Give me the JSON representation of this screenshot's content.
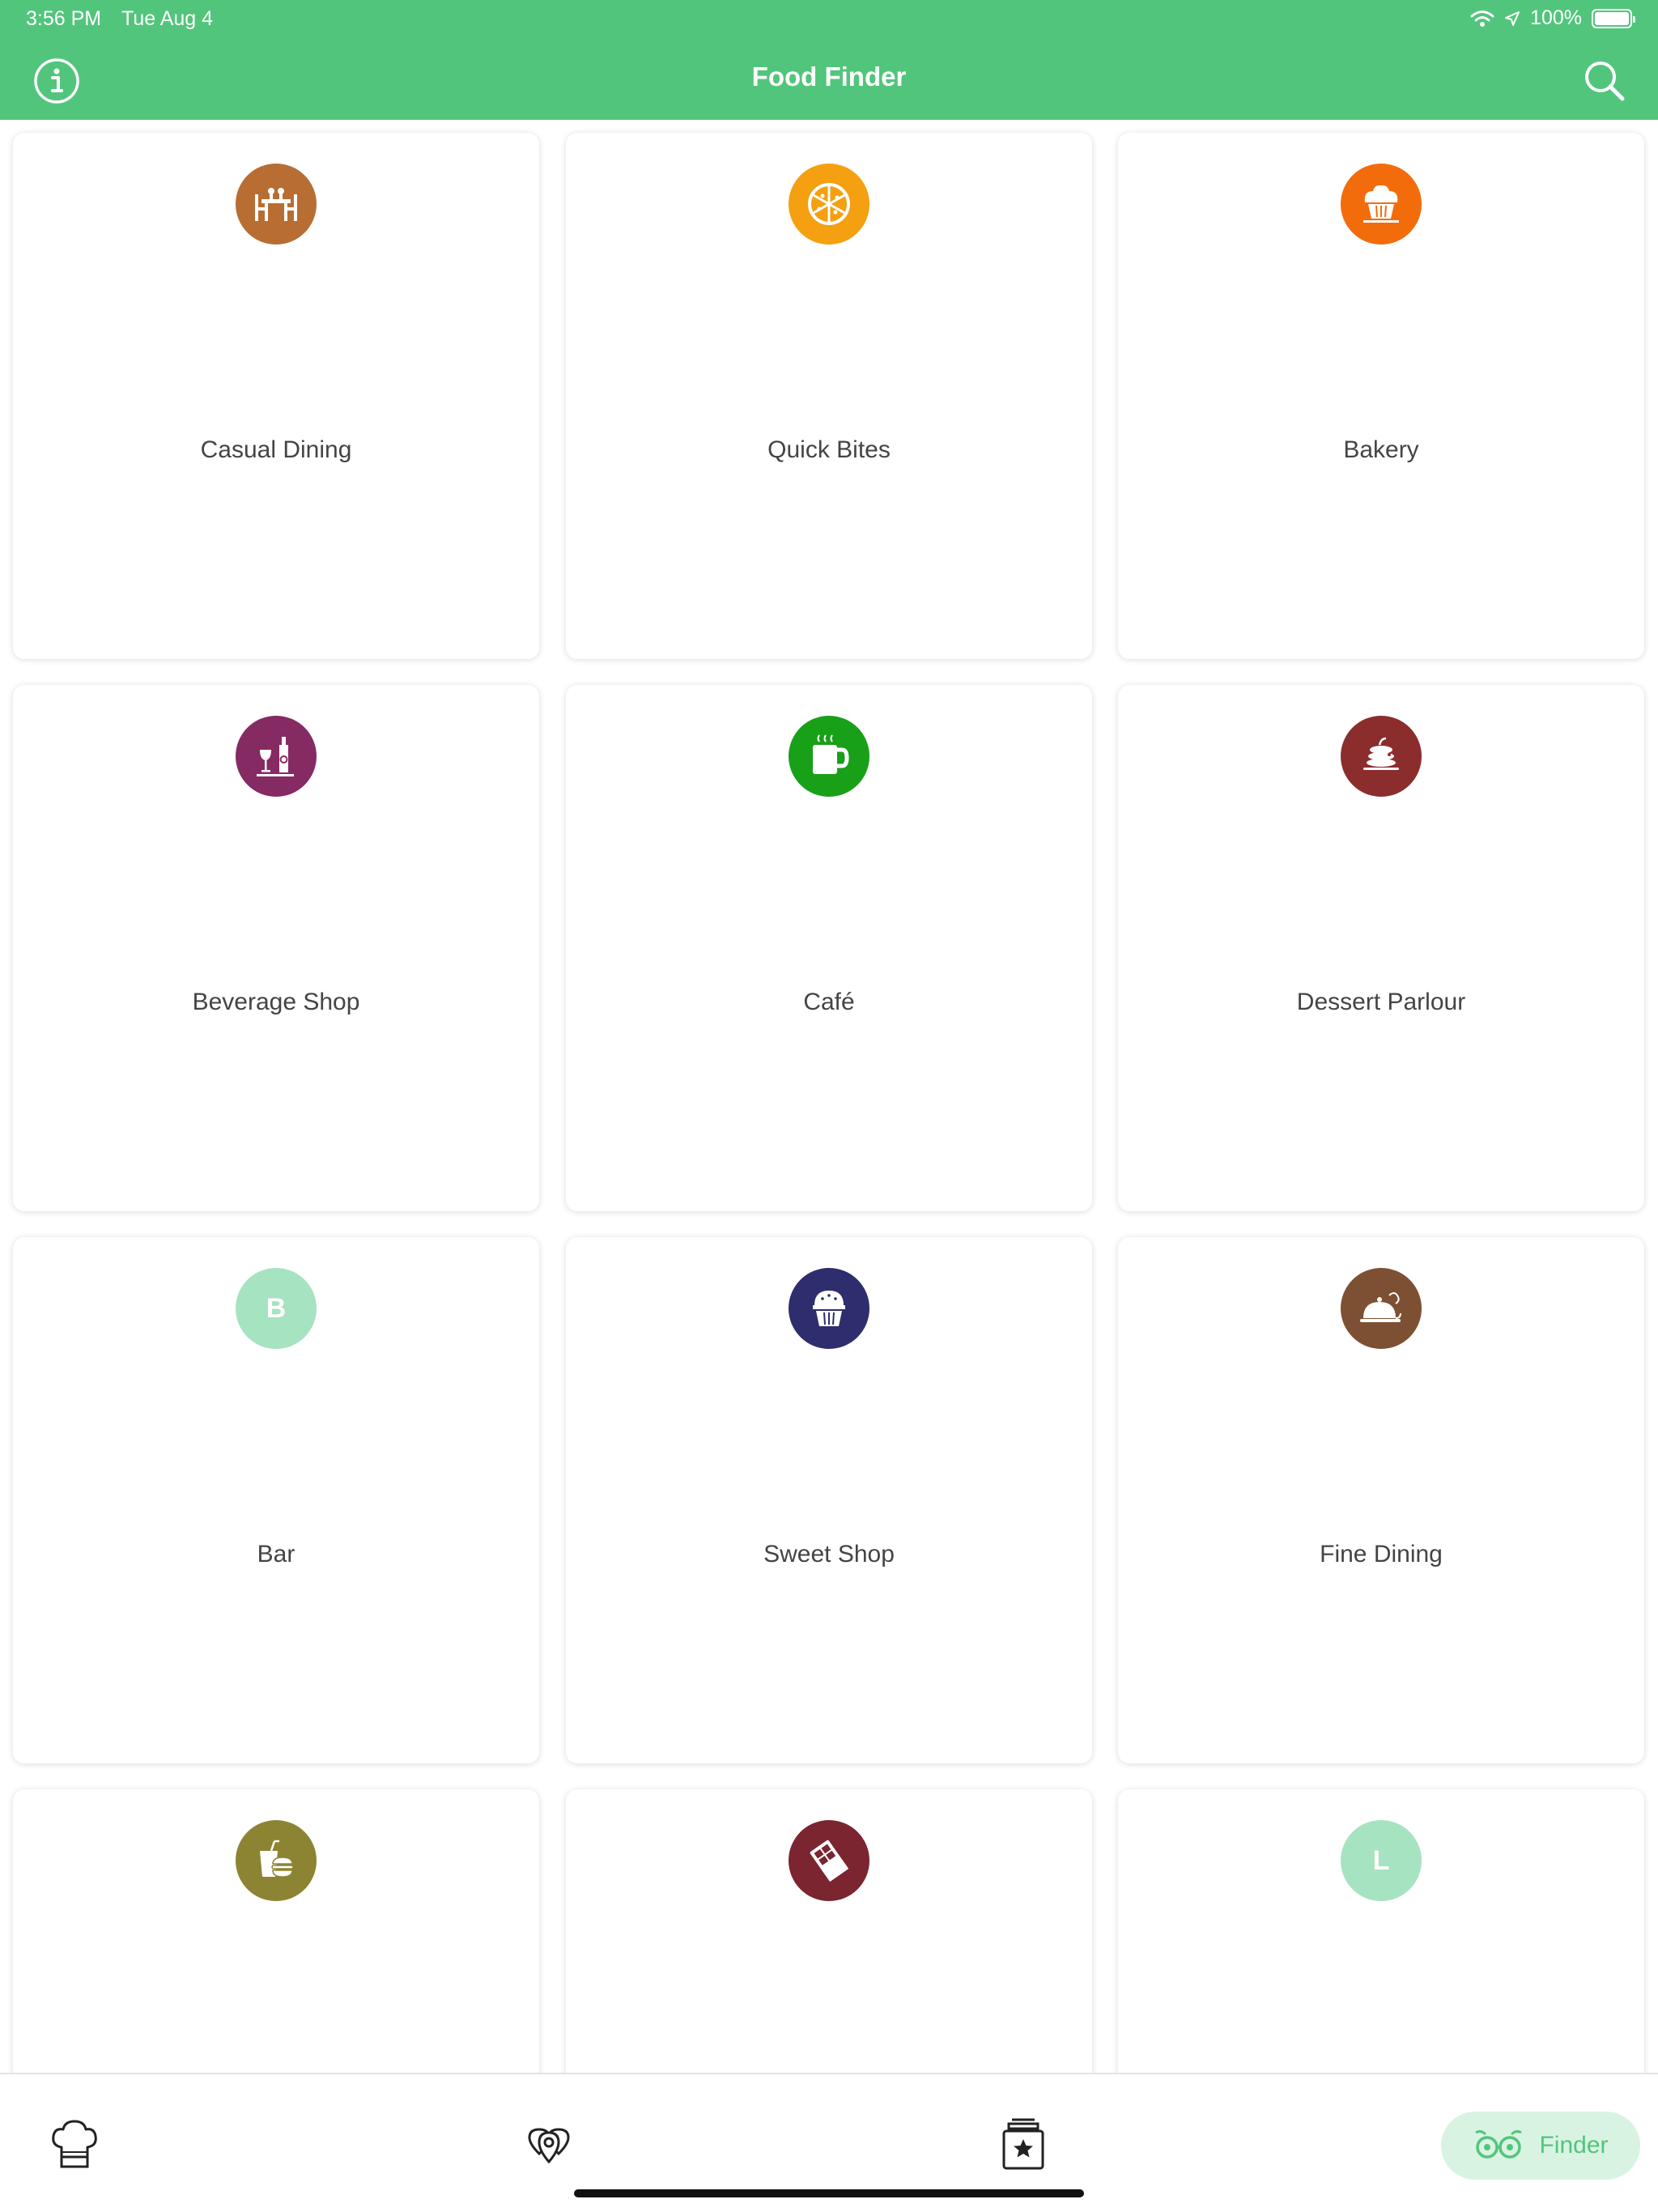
{
  "status_bar": {
    "time": "3:56 PM",
    "date": "Tue Aug 4",
    "battery": "100%"
  },
  "header": {
    "title": "Food Finder",
    "background": "#52c57c"
  },
  "cards": [
    {
      "label": "Casual Dining",
      "icon": "dining-table-icon",
      "color": "#b86d33"
    },
    {
      "label": "Quick Bites",
      "icon": "pizza-icon",
      "color": "#f4a011"
    },
    {
      "label": "Bakery",
      "icon": "cupcake-icon",
      "color": "#f36c0c"
    },
    {
      "label": "Beverage Shop",
      "icon": "wine-bottle-icon",
      "color": "#862a63"
    },
    {
      "label": "Café",
      "icon": "coffee-mug-icon",
      "color": "#18a019"
    },
    {
      "label": "Dessert Parlour",
      "icon": "pancakes-icon",
      "color": "#8b2d2d"
    },
    {
      "label": "Bar",
      "icon": "letter-b-icon",
      "letter": "B",
      "color": "#a6e3c0"
    },
    {
      "label": "Sweet Shop",
      "icon": "muffin-icon",
      "color": "#2e2d6d"
    },
    {
      "label": "Fine Dining",
      "icon": "cloche-icon",
      "color": "#7d5034"
    },
    {
      "label": "",
      "icon": "burger-drink-icon",
      "color": "#8c8432"
    },
    {
      "label": "",
      "icon": "chocolate-bar-icon",
      "color": "#7a2530"
    },
    {
      "label": "",
      "icon": "letter-l-icon",
      "letter": "L",
      "color": "#a6e3c0"
    }
  ],
  "tab_bar": {
    "tabs": [
      {
        "name": "kitchen",
        "icon": "chef-hat-icon"
      },
      {
        "name": "map",
        "icon": "map-pins-icon"
      },
      {
        "name": "favorites",
        "icon": "star-jar-icon"
      },
      {
        "name": "finder",
        "icon": "finder-glasses-icon",
        "label": "Finder",
        "active": true
      }
    ],
    "active_color": "#52c57c",
    "active_background": "#d9f3e3"
  }
}
